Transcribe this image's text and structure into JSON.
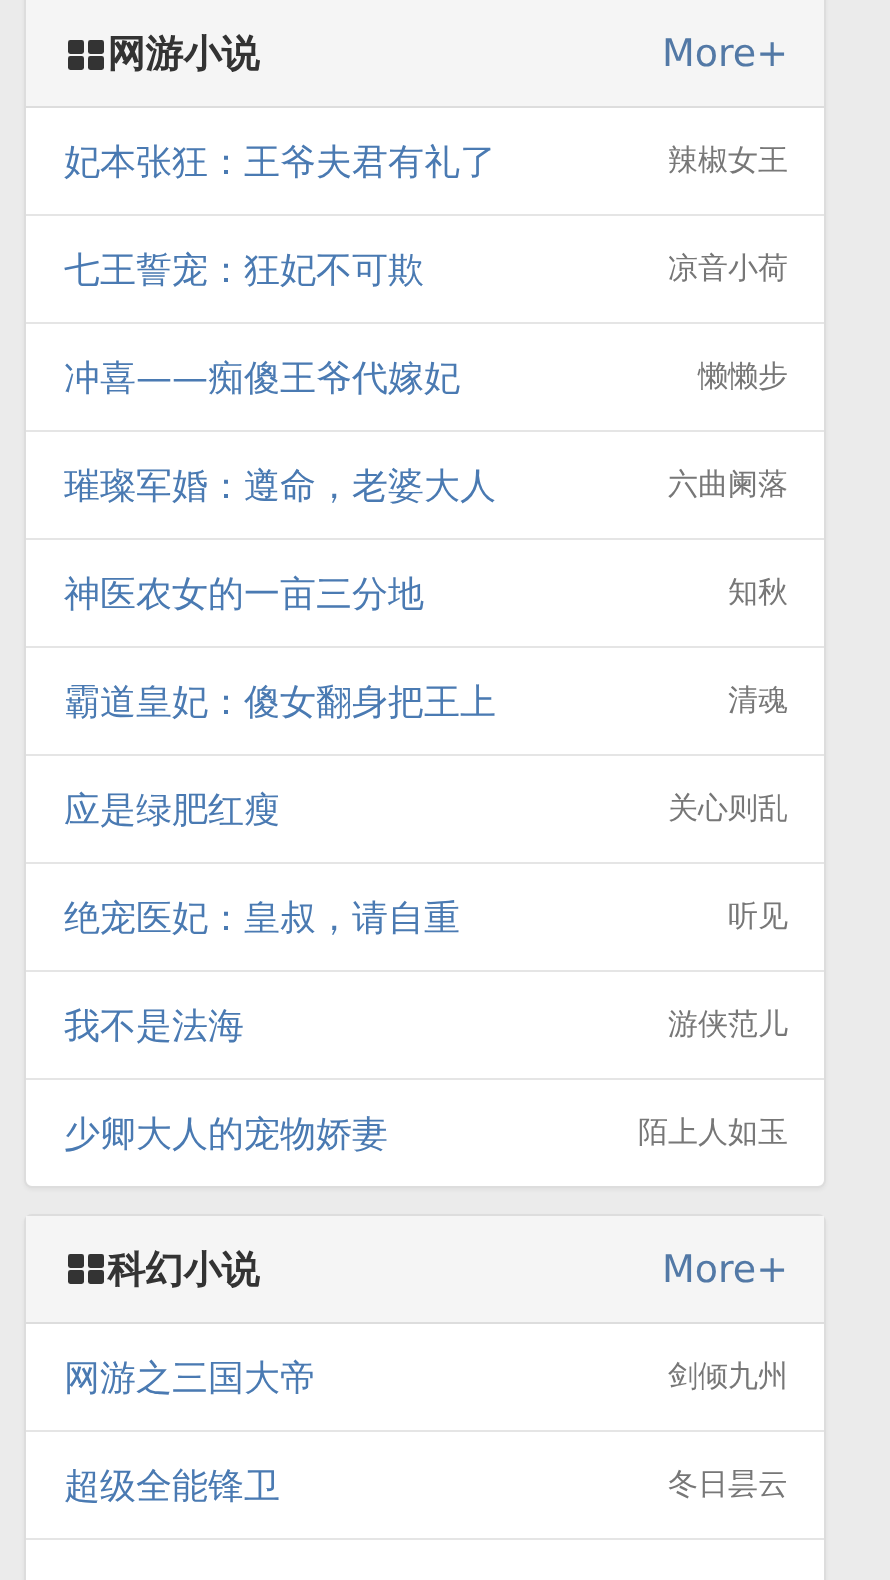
{
  "panels": [
    {
      "title": "网游小说",
      "more": "More+",
      "books": [
        {
          "title": "妃本张狂：王爷夫君有礼了",
          "author": "辣椒女王"
        },
        {
          "title": "七王誓宠：狂妃不可欺",
          "author": "凉音小荷"
        },
        {
          "title": "冲喜——痴傻王爷代嫁妃",
          "author": "懒懒步"
        },
        {
          "title": "璀璨军婚：遵命，老婆大人",
          "author": "六曲阑落"
        },
        {
          "title": "神医农女的一亩三分地",
          "author": "知秋"
        },
        {
          "title": "霸道皇妃：傻女翻身把王上",
          "author": "清魂"
        },
        {
          "title": "应是绿肥红瘦",
          "author": "关心则乱"
        },
        {
          "title": "绝宠医妃：皇叔，请自重",
          "author": "听见"
        },
        {
          "title": "我不是法海",
          "author": "游侠范儿"
        },
        {
          "title": "少卿大人的宠物娇妻",
          "author": "陌上人如玉"
        }
      ]
    },
    {
      "title": "科幻小说",
      "more": "More+",
      "books": [
        {
          "title": "网游之三国大帝",
          "author": "剑倾九州"
        },
        {
          "title": "超级全能锋卫",
          "author": "冬日昙云"
        }
      ]
    }
  ]
}
